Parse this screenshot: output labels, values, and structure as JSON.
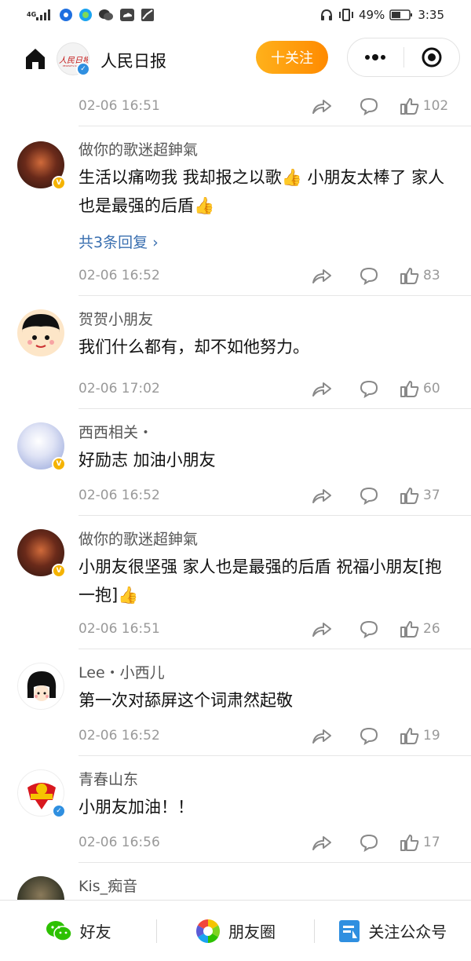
{
  "status_bar": {
    "network_type": "4G",
    "battery_percent": "49%",
    "time": "3:35",
    "icons": [
      "signal-icon",
      "mini-app-icon",
      "browser-icon",
      "wechat-icon",
      "cloud-icon",
      "gallery-icon",
      "headset-icon",
      "vibrate-icon",
      "battery-icon"
    ]
  },
  "header": {
    "title": "人民日报",
    "follow_label": "十关注",
    "brand_logo_text": "人民日报",
    "colors": {
      "follow_gradient_start": "#ffb11b",
      "follow_gradient_end": "#ff8a00"
    }
  },
  "top_partial": {
    "time": "02-06 16:51",
    "likes": "102"
  },
  "comments": [
    {
      "name": "做你的歌迷超鉮氣",
      "text": "生活以痛吻我 我却报之以歌👍 小朋友太棒了 家人也是最强的后盾👍",
      "reply": "共3条回复 ›",
      "time": "02-06 16:52",
      "likes": "83",
      "badge": "gold"
    },
    {
      "name": "贺贺小朋友",
      "text": "我们什么都有，却不如他努力。",
      "time": "02-06 17:02",
      "likes": "60"
    },
    {
      "name": "西西相关・",
      "text": "好励志 加油小朋友",
      "time": "02-06 16:52",
      "likes": "37",
      "badge": "gold"
    },
    {
      "name": "做你的歌迷超鉮氣",
      "text": "小朋友很坚强 家人也是最强的后盾 祝福小朋友[抱一抱]👍",
      "time": "02-06 16:51",
      "likes": "26",
      "badge": "gold"
    },
    {
      "name": "Lee・小西儿",
      "text": "第一次对舔屏这个词肃然起敬",
      "time": "02-06 16:52",
      "likes": "19"
    },
    {
      "name": "青春山东",
      "text": "小朋友加油！！",
      "time": "02-06 16:56",
      "likes": "17",
      "badge": "blue"
    },
    {
      "name": "Kis_痴音"
    }
  ],
  "bottom_bar": {
    "friends_label": "好友",
    "moments_label": "朋友圈",
    "follow_account_label": "关注公众号"
  }
}
